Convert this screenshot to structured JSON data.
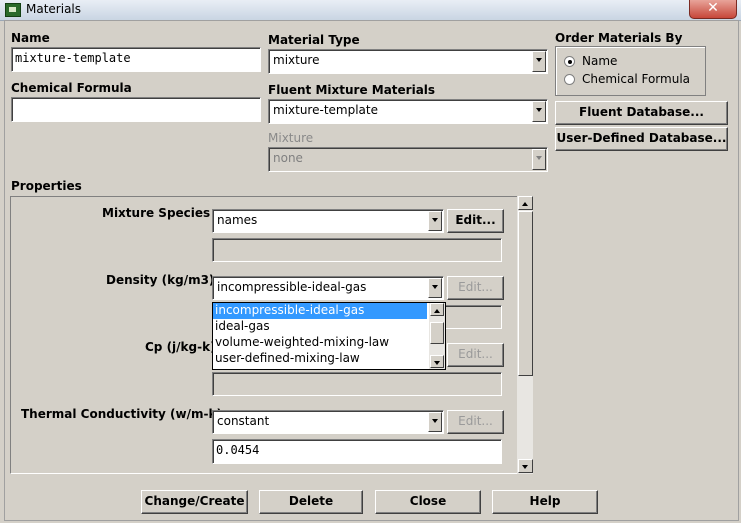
{
  "window": {
    "title": "Materials",
    "close_glyph": "✕"
  },
  "name": {
    "label": "Name",
    "value": "mixture-template"
  },
  "chemical_formula": {
    "label": "Chemical Formula",
    "value": ""
  },
  "material_type": {
    "label": "Material Type",
    "value": "mixture"
  },
  "fluent_mixture": {
    "label": "Fluent Mixture Materials",
    "value": "mixture-template"
  },
  "mixture": {
    "label": "Mixture",
    "value": "none"
  },
  "order_by": {
    "label": "Order Materials By",
    "options": [
      "Name",
      "Chemical Formula"
    ],
    "selected": "Name"
  },
  "buttons": {
    "fluent_db": "Fluent Database...",
    "user_db": "User-Defined Database..."
  },
  "properties": {
    "label": "Properties",
    "mixture_species": {
      "label": "Mixture Species",
      "value": "names",
      "edit": "Edit..."
    },
    "density": {
      "label": "Density (kg/m3)",
      "value": "incompressible-ideal-gas",
      "edit": "Edit..."
    },
    "density_options": [
      "incompressible-ideal-gas",
      "ideal-gas",
      "volume-weighted-mixing-law",
      "user-defined-mixing-law"
    ],
    "cp": {
      "label": "Cp (j/kg-k)",
      "edit": "Edit..."
    },
    "thermal_conductivity": {
      "label": "Thermal Conductivity (w/m-k)",
      "value": "constant",
      "edit": "Edit...",
      "constant": "0.0454"
    }
  },
  "footer": {
    "change": "Change/Create",
    "delete": "Delete",
    "close": "Close",
    "help": "Help"
  }
}
